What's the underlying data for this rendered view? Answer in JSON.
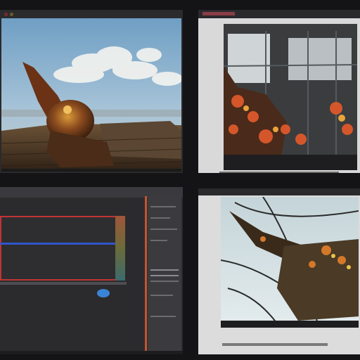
{
  "panels": [
    {
      "id": "render-preview-airship",
      "icon": "image-icon"
    },
    {
      "id": "reference-photo-workshop",
      "icon": "image-icon"
    },
    {
      "id": "editor-timeline",
      "icon": "timeline-icon"
    },
    {
      "id": "reference-photo-closeup",
      "icon": "image-icon"
    }
  ],
  "colors": {
    "background": "#141416",
    "accent_red": "#c03434",
    "accent_blue": "#2f56c8",
    "accent_orange": "#c3552e"
  }
}
